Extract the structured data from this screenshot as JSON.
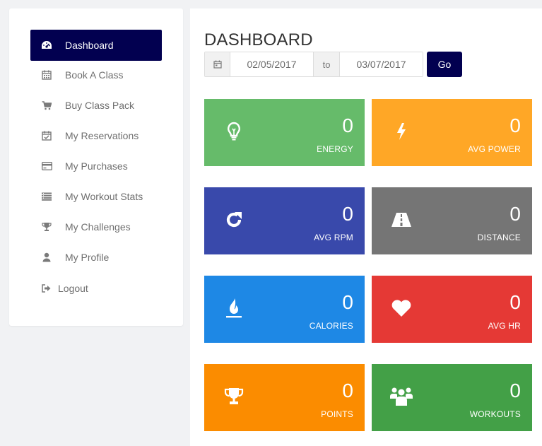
{
  "sidebar": {
    "items": [
      {
        "label": "Dashboard",
        "icon": "dashboard-icon",
        "active": true
      },
      {
        "label": "Book A Class",
        "icon": "calendar-icon",
        "active": false
      },
      {
        "label": "Buy Class Pack",
        "icon": "cart-icon",
        "active": false
      },
      {
        "label": "My Reservations",
        "icon": "calendar-check-icon",
        "active": false
      },
      {
        "label": "My Purchases",
        "icon": "credit-card-icon",
        "active": false
      },
      {
        "label": "My Workout Stats",
        "icon": "list-icon",
        "active": false
      },
      {
        "label": "My Challenges",
        "icon": "trophy-icon",
        "active": false
      },
      {
        "label": "My Profile",
        "icon": "user-icon",
        "active": false
      },
      {
        "label": "Logout",
        "icon": "sign-out-icon",
        "active": false
      }
    ]
  },
  "main": {
    "title": "DASHBOARD",
    "date_range": {
      "start": "02/05/2017",
      "separator": "to",
      "end": "03/07/2017"
    },
    "go_label": "Go",
    "tiles": [
      {
        "label": "ENERGY",
        "value": "0",
        "color": "#66bb6a",
        "icon": "lightbulb-icon"
      },
      {
        "label": "AVG POWER",
        "value": "0",
        "color": "#ffa726",
        "icon": "bolt-icon"
      },
      {
        "label": "AVG RPM",
        "value": "0",
        "color": "#3949ab",
        "icon": "refresh-icon"
      },
      {
        "label": "DISTANCE",
        "value": "0",
        "color": "#757575",
        "icon": "road-icon"
      },
      {
        "label": "CALORIES",
        "value": "0",
        "color": "#1e88e5",
        "icon": "fire-icon"
      },
      {
        "label": "AVG HR",
        "value": "0",
        "color": "#e53935",
        "icon": "heart-icon"
      },
      {
        "label": "POINTS",
        "value": "0",
        "color": "#fb8c00",
        "icon": "trophy-icon"
      },
      {
        "label": "WORKOUTS",
        "value": "0",
        "color": "#43a047",
        "icon": "users-icon"
      }
    ]
  },
  "colors": {
    "accent": "#020050",
    "page_bg": "#f1f2f4"
  }
}
